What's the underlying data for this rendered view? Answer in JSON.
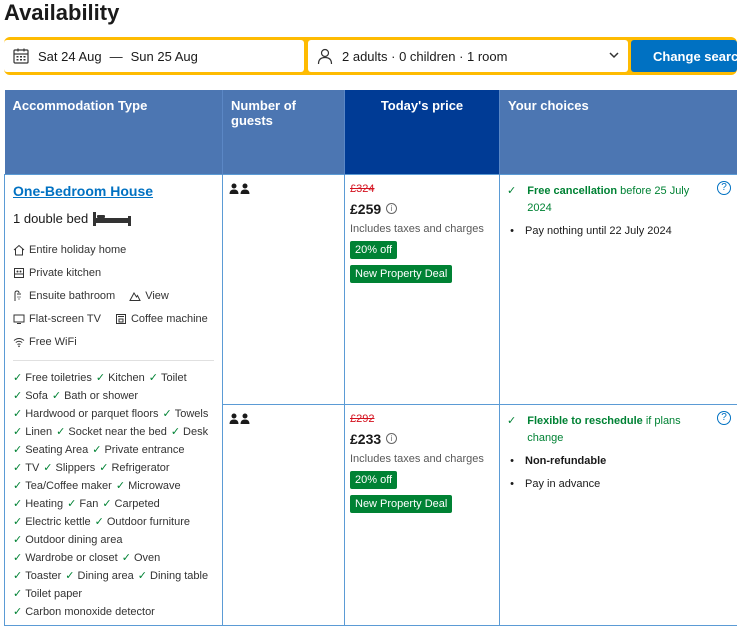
{
  "page": {
    "title": "Availability"
  },
  "search": {
    "checkin": "Sat 24 Aug",
    "separator": "—",
    "checkout": "Sun 25 Aug",
    "guests": "2 adults · 0 children · 1 room",
    "button": "Change search"
  },
  "table": {
    "headers": [
      "Accommodation Type",
      "Number of guests",
      "Today's price",
      "Your choices"
    ]
  },
  "room": {
    "name": "One-Bedroom House",
    "bed": "1 double bed",
    "facilities": {
      "holiday_home": "Entire holiday home",
      "kitchen": "Private kitchen",
      "bathroom": "Ensuite bathroom",
      "view": "View",
      "tv": "Flat-screen TV",
      "coffee": "Coffee machine",
      "wifi": "Free WiFi"
    },
    "amenities": [
      [
        "Free toiletries",
        "Kitchen",
        "Toilet"
      ],
      [
        "Sofa",
        "Bath or shower"
      ],
      [
        "Hardwood or parquet floors",
        "Towels"
      ],
      [
        "Linen",
        "Socket near the bed",
        "Desk"
      ],
      [
        "Seating Area",
        "Private entrance"
      ],
      [
        "TV",
        "Slippers",
        "Refrigerator"
      ],
      [
        "Tea/Coffee maker",
        "Microwave"
      ],
      [
        "Heating",
        "Fan",
        "Carpeted"
      ],
      [
        "Electric kettle",
        "Outdoor furniture"
      ],
      [
        "Outdoor dining area"
      ],
      [
        "Wardrobe or closet",
        "Oven"
      ],
      [
        "Toaster",
        "Dining area",
        "Dining table"
      ],
      [
        "Toilet paper"
      ],
      [
        "Carbon monoxide detector"
      ]
    ]
  },
  "options": [
    {
      "old_price": "£324",
      "price": "£259",
      "includes": "Includes taxes and charges",
      "discount": "20% off",
      "deal": "New Property Deal",
      "choice_title": "Free cancellation",
      "choice_suffix": " before 25 July 2024",
      "line2": "Pay nothing until 22 July 2024"
    },
    {
      "old_price": "£292",
      "price": "£233",
      "includes": "Includes taxes and charges",
      "discount": "20% off",
      "deal": "New Property Deal",
      "choice_title": "Flexible to reschedule",
      "choice_suffix": " if plans change",
      "line2": "Non-refundable",
      "line3": "Pay in advance"
    }
  ],
  "colors": {
    "accent": "#0071c2",
    "header": "#4c76b2",
    "price_header": "#003b95",
    "search_border": "#febb02",
    "green": "#008234",
    "strike": "#d4111e"
  }
}
